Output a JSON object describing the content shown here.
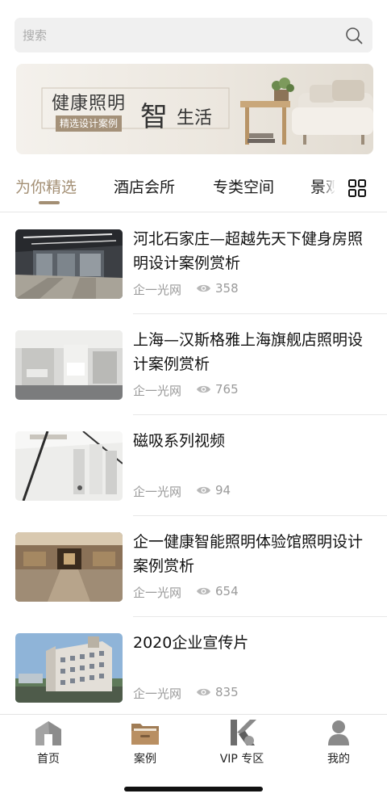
{
  "search": {
    "placeholder": "搜索",
    "icon": "search-icon"
  },
  "banner": {
    "title": "健康照明",
    "tag": "精选设计案例",
    "highlight": "智",
    "suffix": "生活"
  },
  "tabs": {
    "items": [
      {
        "label": "为你精选",
        "active": true
      },
      {
        "label": "酒店会所",
        "active": false
      },
      {
        "label": "专类空间",
        "active": false
      },
      {
        "label": "景观",
        "active": false
      }
    ],
    "accent_color": "#a38f74",
    "more_icon": "grid-icon"
  },
  "articles": [
    {
      "title": "河北石家庄—超越先天下健身房照明设计案例赏析",
      "source": "企一光网",
      "views": "358",
      "thumb_icon": "gym-photo"
    },
    {
      "title": "上海—汉斯格雅上海旗舰店照明设计案例赏析",
      "source": "企一光网",
      "views": "765",
      "thumb_icon": "showroom-photo"
    },
    {
      "title": "磁吸系列视频",
      "source": "企一光网",
      "views": "94",
      "thumb_icon": "track-light-photo"
    },
    {
      "title": "企一健康智能照明体验馆照明设计案例赏析",
      "source": "企一光网",
      "views": "654",
      "thumb_icon": "exhibition-hall-photo"
    },
    {
      "title": "2020企业宣传片",
      "source": "企一光网",
      "views": "835",
      "thumb_icon": "building-photo"
    }
  ],
  "bottom_nav": {
    "items": [
      {
        "label": "首页",
        "icon": "home-icon"
      },
      {
        "label": "案例",
        "icon": "folder-icon"
      },
      {
        "label": "VIP 专区",
        "icon": "vip-logo-icon"
      },
      {
        "label": "我的",
        "icon": "user-icon"
      }
    ]
  },
  "colors": {
    "accent": "#a38f74",
    "meta_text": "#9a9a9a",
    "search_bg": "#f0f0f0"
  }
}
